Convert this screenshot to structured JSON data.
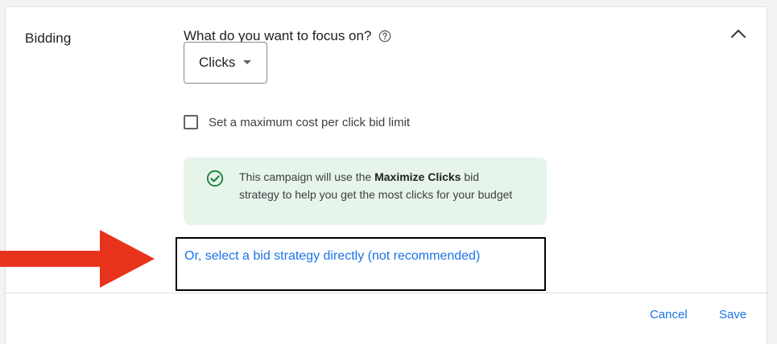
{
  "section": {
    "title": "Bidding"
  },
  "focus": {
    "question": "What do you want to focus on?",
    "help_icon": "help-circle-icon",
    "selected": "Clicks"
  },
  "max_cpc": {
    "label": "Set a maximum cost per click bid limit",
    "checked": false
  },
  "info": {
    "icon": "check-circle-icon",
    "text_before": "This campaign will use the ",
    "strategy": "Maximize Clicks",
    "text_after": " bid strategy to help you get the most clicks for your budget"
  },
  "link": {
    "label": "Or, select a bid strategy directly (not recommended)"
  },
  "footer": {
    "cancel_label": "Cancel",
    "save_label": "Save"
  },
  "annotation": {
    "arrow_color": "#e8331c"
  },
  "colors": {
    "link_blue": "#1a73e8",
    "info_bg": "#e6f4ea",
    "success_green": "#188038"
  }
}
